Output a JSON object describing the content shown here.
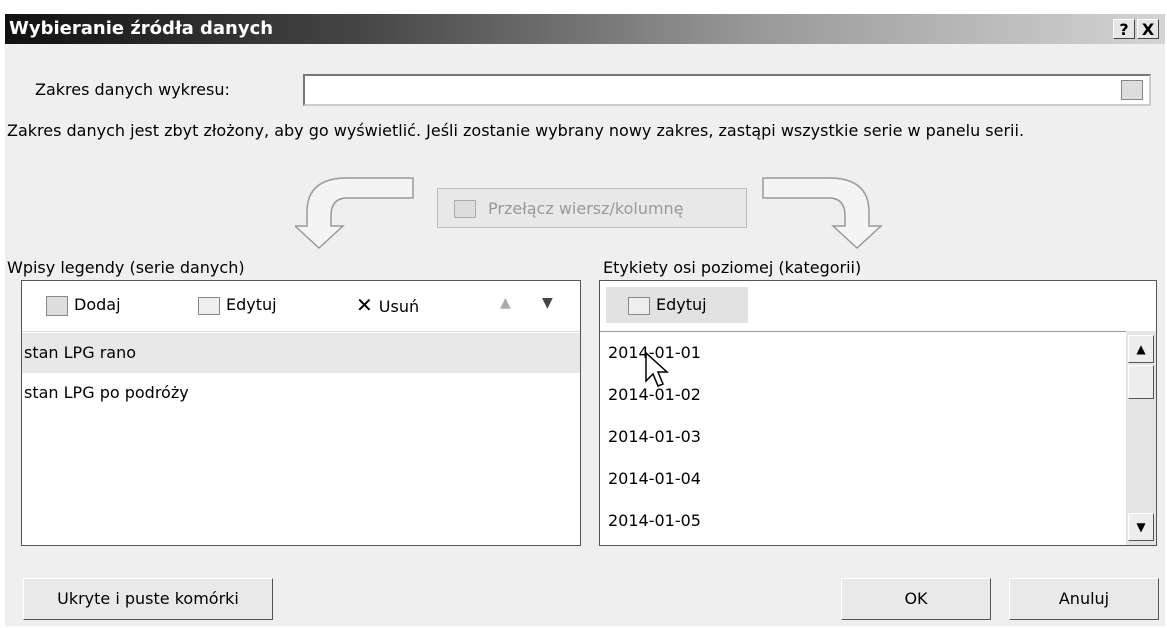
{
  "dialog": {
    "title": "Wybieranie źródła danych",
    "help_button": "?",
    "close_button": "X"
  },
  "range": {
    "label": "Zakres danych wykresu:",
    "value": "",
    "message": "Zakres danych jest zbyt złożony, aby go wyświetlić. Jeśli zostanie wybrany nowy zakres, zastąpi wszystkie serie w panelu serii."
  },
  "switch_button": "Przełącz wiersz/kolumnę",
  "legend": {
    "label": "Wpisy legendy (serie danych)",
    "toolbar": {
      "add": "Dodaj",
      "edit": "Edytuj",
      "remove": "Usuń"
    },
    "series": [
      "stan LPG rano",
      "stan LPG po podróży"
    ],
    "selected_index": 0
  },
  "categories": {
    "label": "Etykiety osi poziomej (kategorii)",
    "edit": "Edytuj",
    "items": [
      "2014-01-01",
      "2014-01-02",
      "2014-01-03",
      "2014-01-04",
      "2014-01-05"
    ]
  },
  "footer": {
    "hidden_cells": "Ukryte i puste komórki",
    "ok": "OK",
    "cancel": "Anuluj"
  }
}
